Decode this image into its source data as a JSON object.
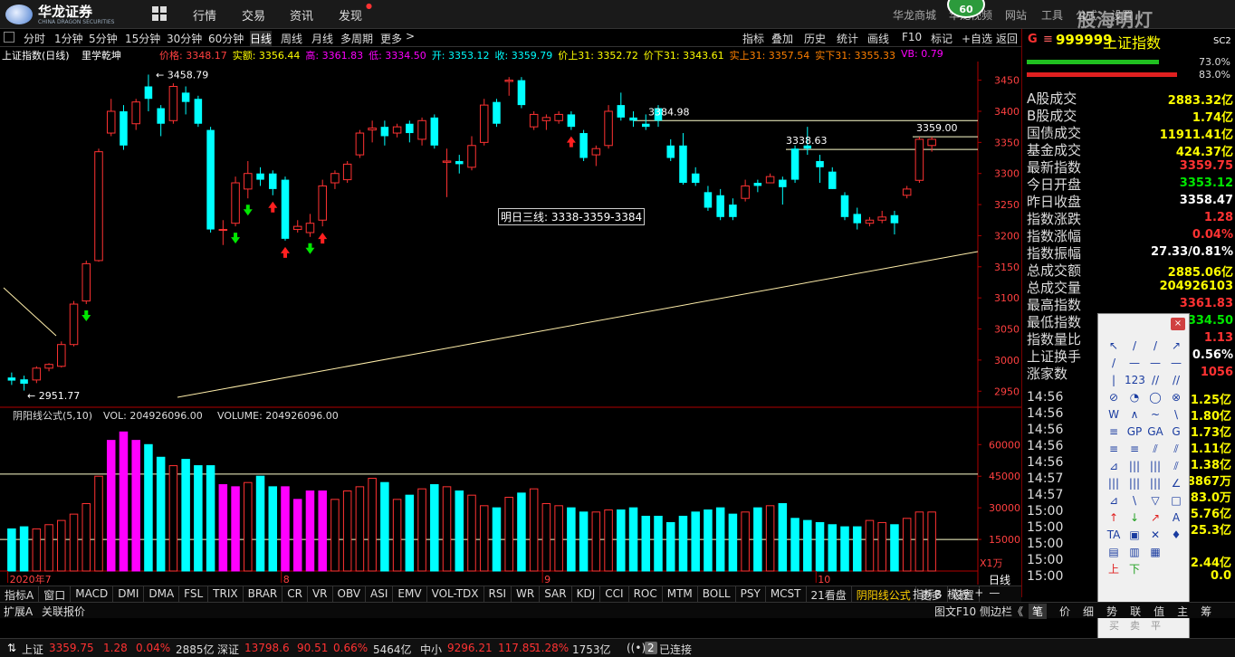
{
  "brand": {
    "name": "华龙证券",
    "sub": "CHINA DRAGON SECURITIES"
  },
  "menu_main": [
    "行情",
    "交易",
    "资讯",
    "发现"
  ],
  "menu_right": [
    "华龙商城",
    "华龙视频",
    "网站",
    "工具",
    "公式",
    "设置"
  ],
  "badge": "60",
  "watermark": "股海明灯",
  "periods": [
    "分时",
    "1分钟",
    "5分钟",
    "15分钟",
    "30分钟",
    "60分钟",
    "日线",
    "周线",
    "月线",
    "多周期",
    "更多"
  ],
  "active_period": "日线",
  "chart_tools": [
    "指标",
    "叠加",
    "历史",
    "统计",
    "画线",
    "F10",
    "标记",
    "+自选",
    "返回"
  ],
  "info": {
    "title": "上证指数(日线)",
    "formula": "里学乾坤",
    "items": [
      {
        "t": "价格: 3348.17",
        "c": "#ff4040"
      },
      {
        "t": "实额: 3356.44",
        "c": "#ffff00"
      },
      {
        "t": "高: 3361.83",
        "c": "#ff00ff"
      },
      {
        "t": "低: 3334.50",
        "c": "#ff00ff"
      },
      {
        "t": "开: 3353.12",
        "c": "#00ffff"
      },
      {
        "t": "收: 3359.79",
        "c": "#00ffff"
      },
      {
        "t": "价上31: 3352.72",
        "c": "#ffff00"
      },
      {
        "t": "价下31: 3343.61",
        "c": "#ffff00"
      },
      {
        "t": "实上31: 3357.54",
        "c": "#ff8000"
      },
      {
        "t": "实下31: 3355.33",
        "c": "#ff8000"
      },
      {
        "t": "VB: 0.79",
        "c": "#ff00ff"
      }
    ]
  },
  "chart_data": {
    "type": "candlestick",
    "ylim": [
      2930,
      3480
    ],
    "y_ticks": [
      2950,
      3000,
      3050,
      3100,
      3150,
      3200,
      3250,
      3300,
      3350,
      3400,
      3450
    ],
    "month_labels": [
      {
        "i": 0,
        "t": "2020年7"
      },
      {
        "i": 22,
        "t": "8"
      },
      {
        "i": 43,
        "t": "9"
      },
      {
        "i": 65,
        "t": "10"
      }
    ],
    "candles": [
      [
        2972,
        2967,
        2980,
        2960
      ],
      [
        2969,
        2962,
        2975,
        2951
      ],
      [
        2968,
        2987,
        2990,
        2963
      ],
      [
        2987,
        2993,
        2995,
        2982
      ],
      [
        2990,
        3025,
        3030,
        2988
      ],
      [
        3025,
        3090,
        3095,
        3022
      ],
      [
        3095,
        3155,
        3160,
        3090
      ],
      [
        3160,
        3335,
        3340,
        3158
      ],
      [
        3365,
        3400,
        3420,
        3360
      ],
      [
        3400,
        3345,
        3410,
        3338
      ],
      [
        3380,
        3415,
        3420,
        3370
      ],
      [
        3440,
        3420,
        3459,
        3400
      ],
      [
        3405,
        3380,
        3410,
        3360
      ],
      [
        3385,
        3440,
        3445,
        3380
      ],
      [
        3430,
        3415,
        3440,
        3395
      ],
      [
        3420,
        3380,
        3425,
        3375
      ],
      [
        3370,
        3210,
        3375,
        3205
      ],
      [
        3210,
        3210,
        3225,
        3185
      ],
      [
        3220,
        3285,
        3295,
        3215
      ],
      [
        3275,
        3300,
        3320,
        3260
      ],
      [
        3300,
        3290,
        3310,
        3280
      ],
      [
        3300,
        3275,
        3305,
        3265
      ],
      [
        3290,
        3195,
        3295,
        3192
      ],
      [
        3210,
        3215,
        3225,
        3205
      ],
      [
        3205,
        3220,
        3235,
        3198
      ],
      [
        3225,
        3280,
        3290,
        3215
      ],
      [
        3285,
        3300,
        3305,
        3275
      ],
      [
        3290,
        3315,
        3320,
        3285
      ],
      [
        3330,
        3365,
        3370,
        3325
      ],
      [
        3370,
        3373,
        3385,
        3350
      ],
      [
        3375,
        3360,
        3385,
        3345
      ],
      [
        3365,
        3375,
        3380,
        3358
      ],
      [
        3380,
        3365,
        3385,
        3350
      ],
      [
        3355,
        3385,
        3390,
        3345
      ],
      [
        3390,
        3345,
        3395,
        3340
      ],
      [
        3318,
        3320,
        3340,
        3262
      ],
      [
        3320,
        3315,
        3330,
        3300
      ],
      [
        3310,
        3345,
        3360,
        3305
      ],
      [
        3350,
        3410,
        3420,
        3345
      ],
      [
        3415,
        3380,
        3420,
        3375
      ],
      [
        3448,
        3450,
        3455,
        3425
      ],
      [
        3450,
        3410,
        3455,
        3405
      ],
      [
        3375,
        3395,
        3400,
        3370
      ],
      [
        3385,
        3390,
        3395,
        3370
      ],
      [
        3385,
        3395,
        3400,
        3380
      ],
      [
        3395,
        3375,
        3400,
        3370
      ],
      [
        3365,
        3325,
        3370,
        3320
      ],
      [
        3330,
        3340,
        3345,
        3312
      ],
      [
        3345,
        3400,
        3410,
        3340
      ],
      [
        3410,
        3390,
        3430,
        3385
      ],
      [
        3390,
        3385,
        3400,
        3375
      ],
      [
        3380,
        3375,
        3395,
        3370
      ],
      [
        3405,
        3385,
        3410,
        3375
      ],
      [
        3345,
        3325,
        3355,
        3320
      ],
      [
        3345,
        3285,
        3365,
        3282
      ],
      [
        3300,
        3285,
        3310,
        3280
      ],
      [
        3270,
        3245,
        3280,
        3240
      ],
      [
        3265,
        3230,
        3275,
        3225
      ],
      [
        3250,
        3230,
        3260,
        3225
      ],
      [
        3260,
        3280,
        3290,
        3255
      ],
      [
        3285,
        3280,
        3290,
        3270
      ],
      [
        3285,
        3295,
        3300,
        3285
      ],
      [
        3290,
        3278,
        3295,
        3250
      ],
      [
        3340,
        3290,
        3345,
        3285
      ],
      [
        3345,
        3340,
        3375,
        3330
      ],
      [
        3320,
        3310,
        3330,
        3285
      ],
      [
        3303,
        3275,
        3310,
        3275
      ],
      [
        3265,
        3230,
        3270,
        3225
      ],
      [
        3235,
        3220,
        3245,
        3210
      ],
      [
        3220,
        3225,
        3230,
        3215
      ],
      [
        3225,
        3230,
        3240,
        3220
      ],
      [
        3233,
        3220,
        3240,
        3202
      ],
      [
        3265,
        3275,
        3280,
        3260
      ],
      [
        3289,
        3355,
        3359,
        3285
      ],
      [
        3345,
        3355,
        3359,
        3335
      ]
    ],
    "price_labels": [
      {
        "t": "3458.79"
      },
      {
        "t": "2951.77"
      },
      {
        "t": "3384.98"
      },
      {
        "t": "3338.63"
      },
      {
        "t": "3359.00"
      }
    ],
    "annotation": "明日三线: 3338-3359-3384",
    "vol": {
      "title": "阴阳线公式(5,10)",
      "vol_label": "VOL: 204926096.00",
      "volume_label": "VOLUME: 204926096.00",
      "ylim": [
        0,
        70000
      ],
      "y_ticks": [
        15000,
        30000,
        45000,
        60000
      ],
      "unit": "X1万",
      "values": [
        20000,
        21000,
        20000,
        22000,
        24000,
        27000,
        32000,
        45000,
        62000,
        66000,
        62000,
        60000,
        54000,
        50000,
        53000,
        50000,
        50000,
        41000,
        40000,
        42000,
        45000,
        40000,
        40000,
        34000,
        38000,
        38000,
        34000,
        38000,
        40000,
        44000,
        42000,
        34000,
        36000,
        39000,
        41000,
        40000,
        38000,
        36000,
        31000,
        30000,
        35000,
        37000,
        39000,
        32000,
        31000,
        30000,
        28000,
        28000,
        29000,
        29000,
        30000,
        26000,
        26000,
        23000,
        26000,
        28000,
        29000,
        30000,
        27000,
        28000,
        30000,
        31000,
        32000,
        25000,
        24000,
        23000,
        22000,
        21000,
        21000,
        24000,
        23000,
        22000,
        25000,
        28000,
        28000
      ]
    }
  },
  "right_panel": {
    "code": "999999",
    "name": "上证指数",
    "g": "G",
    "sc": "SC2",
    "bars": [
      {
        "pct": "73.0%",
        "v": 0.73
      },
      {
        "pct": "83.0%",
        "v": 0.83
      }
    ],
    "rows": [
      {
        "l": "A股成交",
        "v": "2883.32亿",
        "c": "#ffff00"
      },
      {
        "l": "B股成交",
        "v": "1.74亿",
        "c": "#ffff00"
      },
      {
        "l": "国债成交",
        "v": "11911.41亿",
        "c": "#ffff00"
      },
      {
        "l": "基金成交",
        "v": "424.37亿",
        "c": "#ffff00"
      },
      {
        "l": "最新指数",
        "v": "3359.75",
        "c": "#ff3232"
      },
      {
        "l": "今日开盘",
        "v": "3353.12",
        "c": "#00e600"
      },
      {
        "l": "昨日收盘",
        "v": "3358.47",
        "c": "#ffffff"
      },
      {
        "l": "指数涨跌",
        "v": "1.28",
        "c": "#ff3232"
      },
      {
        "l": "指数涨幅",
        "v": "0.04%",
        "c": "#ff3232"
      },
      {
        "l": "指数振幅",
        "v": "27.33/0.81%",
        "c": "#ffffff"
      },
      {
        "l": "总成交额",
        "v": "2885.06亿",
        "c": "#ffff00"
      },
      {
        "l": "总成交量",
        "v": "204926103",
        "c": "#ffff00"
      },
      {
        "l": "最高指数",
        "v": "3361.83",
        "c": "#ff3232"
      },
      {
        "l": "最低指数",
        "v": "3334.50",
        "c": "#00e600"
      },
      {
        "l": "指数量比",
        "v": "1.13",
        "c": "#ff3232"
      },
      {
        "l": "上证换手",
        "v": "0.56%",
        "c": "#ffffff"
      },
      {
        "l": "涨家数",
        "v": "1056",
        "c": "#ff3232"
      }
    ],
    "ticks": [
      {
        "t": "14:56",
        "v": "1.25亿",
        "c": "#ffff00"
      },
      {
        "t": "14:56",
        "v": "1.80亿",
        "c": "#ffff00"
      },
      {
        "t": "14:56",
        "v": "1.73亿",
        "c": "#ffff00"
      },
      {
        "t": "14:56",
        "v": "1.11亿",
        "c": "#ffff00"
      },
      {
        "t": "14:56",
        "v": "1.38亿",
        "c": "#ffff00"
      },
      {
        "t": "14:57",
        "v": "8867万",
        "c": "#ffff00"
      },
      {
        "t": "14:57",
        "v": "83.0万",
        "c": "#ffff00"
      },
      {
        "t": "15:00",
        "v": "5.76亿",
        "c": "#ffff00"
      },
      {
        "t": "15:00",
        "v": "25.3亿",
        "c": "#ffff00"
      },
      {
        "t": "15:00",
        "v": "",
        "c": "#ffff00"
      },
      {
        "t": "15:00",
        "v": "2.44亿",
        "c": "#ffff00"
      },
      {
        "t": "15:00",
        "v": "0.0",
        "c": "#ffff00"
      }
    ]
  },
  "draw_tools": {
    "close_label": "×",
    "icons": [
      "↖",
      "/",
      "/",
      "↗",
      "/",
      "—",
      "—",
      "—",
      "|",
      "123",
      "//",
      "//",
      "⊘",
      "◔",
      "◯",
      "⊗",
      "W",
      "∧",
      "~",
      "\\",
      "≡",
      "GP",
      "GA",
      "G",
      "≡",
      "≡",
      "⫽",
      "⫽",
      "⊿",
      "|||",
      "|||",
      "⫽",
      "|||",
      "|||",
      "|||",
      "∠",
      "⊿",
      "\\",
      "▽",
      "□",
      "↑",
      "↓",
      "↗",
      "A",
      "TA",
      "▣",
      "✕",
      "♦",
      "▤",
      "▥",
      "▦",
      "",
      "上",
      "下",
      "",
      ""
    ],
    "trade": [
      "买",
      "卖",
      "平"
    ]
  },
  "indicators": [
    "指标A",
    "窗口",
    "MACD",
    "DMI",
    "DMA",
    "FSL",
    "TRIX",
    "BRAR",
    "CR",
    "VR",
    "OBV",
    "ASI",
    "EMV",
    "VOL-TDX",
    "RSI",
    "WR",
    "SAR",
    "KDJ",
    "CCI",
    "ROC",
    "MTM",
    "BOLL",
    "PSY",
    "MCST",
    "21看盘",
    "阴阳线公式",
    "更多",
    "设置"
  ],
  "active_indicator": "阴阳线公式",
  "indicator_right": [
    "指标B",
    "模板",
    "+",
    "—"
  ],
  "period_label": "日线",
  "ext": {
    "left": "扩展A",
    "mid": "关联报价",
    "right": "图文F10",
    "side": "侧边栏《",
    "tabs": [
      "笔",
      "价",
      "细",
      "势",
      "联",
      "值",
      "主",
      "筹"
    ]
  },
  "status": {
    "sh": {
      "n": "上证",
      "p": "3359.75",
      "c": "1.28",
      "pc": "0.04%",
      "a": "2885亿"
    },
    "sz": {
      "n": "深证",
      "p": "13798.6",
      "c": "90.51",
      "pc": "0.66%",
      "a": "5464亿"
    },
    "zx": {
      "n": "中小",
      "p": "9296.21",
      "c": "117.85",
      "pc": "1.28%",
      "a": "1753亿"
    },
    "conn": "已连接",
    "conn_n": "2"
  }
}
